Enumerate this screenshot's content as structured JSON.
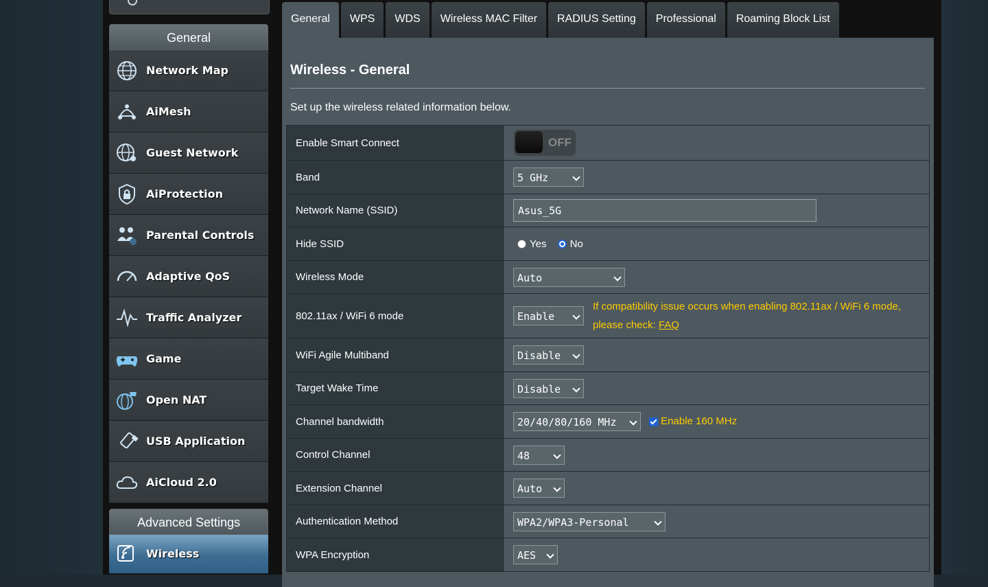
{
  "sidebar": {
    "general_header": "General",
    "items": [
      {
        "label": "Network Map",
        "icon": "globe-icon"
      },
      {
        "label": "AiMesh",
        "icon": "mesh-icon"
      },
      {
        "label": "Guest Network",
        "icon": "guest-globe-icon"
      },
      {
        "label": "AiProtection",
        "icon": "shield-lock-icon"
      },
      {
        "label": "Parental Controls",
        "icon": "family-icon"
      },
      {
        "label": "Adaptive QoS",
        "icon": "speedometer-icon"
      },
      {
        "label": "Traffic Analyzer",
        "icon": "pulse-icon"
      },
      {
        "label": "Game",
        "icon": "gamepad-icon"
      },
      {
        "label": "Open NAT",
        "icon": "gamepad-globe-icon"
      },
      {
        "label": "USB Application",
        "icon": "usb-icon"
      },
      {
        "label": "AiCloud 2.0",
        "icon": "cloud-icon"
      }
    ],
    "advanced_header": "Advanced Settings",
    "advanced_items": [
      {
        "label": "Wireless",
        "icon": "wireless-icon"
      }
    ]
  },
  "tabs": [
    "General",
    "WPS",
    "WDS",
    "Wireless MAC Filter",
    "RADIUS Setting",
    "Professional",
    "Roaming Block List"
  ],
  "page": {
    "title": "Wireless - General",
    "description": "Set up the wireless related information below."
  },
  "form": {
    "smart_connect": {
      "label": "Enable Smart Connect",
      "state": "OFF"
    },
    "band": {
      "label": "Band",
      "value": "5 GHz"
    },
    "ssid": {
      "label": "Network Name (SSID)",
      "value": "Asus_5G"
    },
    "hide_ssid": {
      "label": "Hide SSID",
      "yes": "Yes",
      "no": "No"
    },
    "wireless_mode": {
      "label": "Wireless Mode",
      "value": "Auto"
    },
    "wifi6": {
      "label": "802.11ax / WiFi 6 mode",
      "value": "Enable",
      "note_line1": "If compatibility issue occurs when enabling 802.11ax / WiFi 6 mode,",
      "note_line2": "please check: ",
      "note_link": "FAQ"
    },
    "agile": {
      "label": "WiFi Agile Multiband",
      "value": "Disable"
    },
    "twt": {
      "label": "Target Wake Time",
      "value": "Disable"
    },
    "bandwidth": {
      "label": "Channel bandwidth",
      "value": "20/40/80/160 MHz",
      "check_label": "Enable 160 MHz"
    },
    "control_channel": {
      "label": "Control Channel",
      "value": "48"
    },
    "ext_channel": {
      "label": "Extension Channel",
      "value": "Auto"
    },
    "auth": {
      "label": "Authentication Method",
      "value": "WPA2/WPA3-Personal"
    },
    "wpa_enc": {
      "label": "WPA Encryption",
      "value": "AES"
    }
  },
  "colors": {
    "accent_note": "#ffcc00",
    "active_blue": "#3d6d93"
  }
}
